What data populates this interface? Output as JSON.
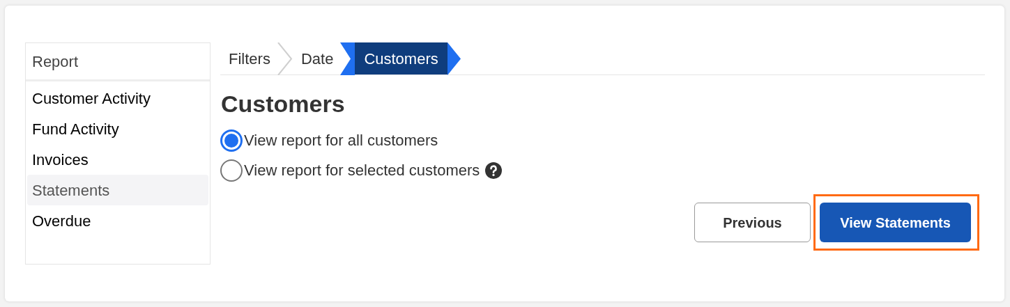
{
  "sidebar": {
    "title": "Report",
    "items": [
      {
        "label": "Customer Activity",
        "selected": false
      },
      {
        "label": "Fund Activity",
        "selected": false
      },
      {
        "label": "Invoices",
        "selected": false
      },
      {
        "label": "Statements",
        "selected": true
      },
      {
        "label": "Overdue",
        "selected": false
      }
    ]
  },
  "steps": [
    {
      "label": "Filters",
      "selected": false
    },
    {
      "label": "Date",
      "selected": false
    },
    {
      "label": "Customers",
      "selected": true
    }
  ],
  "heading": "Customers",
  "options": [
    {
      "label": "View report for all customers",
      "selected": true,
      "help": false
    },
    {
      "label": "View report for selected customers",
      "selected": false,
      "help": true
    }
  ],
  "buttons": [
    {
      "label": "Previous",
      "kind": "secondary",
      "highlighted": false
    },
    {
      "label": "View Statements",
      "kind": "primary",
      "highlighted": true
    }
  ]
}
